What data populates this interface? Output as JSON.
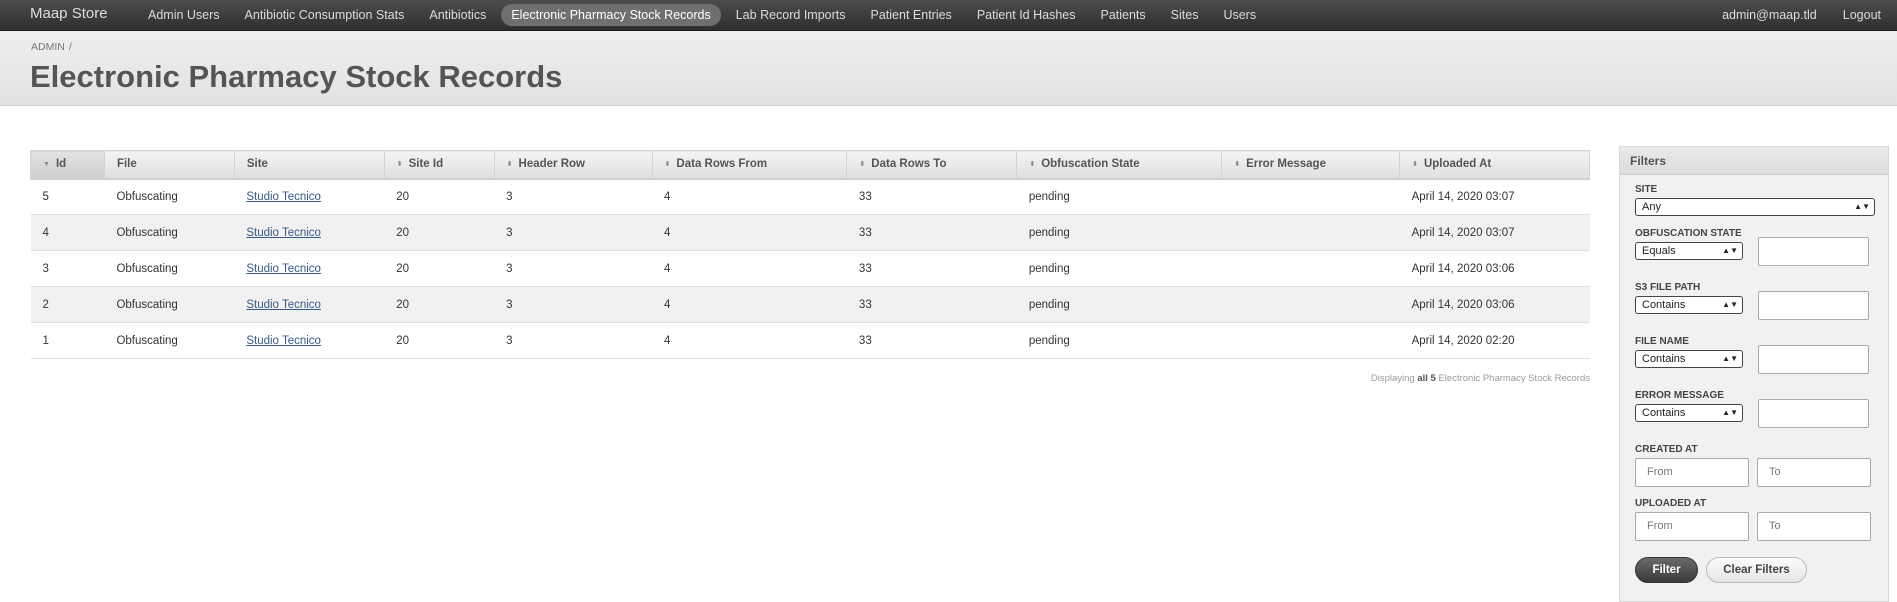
{
  "brand": "Maap Store",
  "nav": {
    "items": [
      {
        "label": "Admin Users",
        "active": false
      },
      {
        "label": "Antibiotic Consumption Stats",
        "active": false
      },
      {
        "label": "Antibiotics",
        "active": false
      },
      {
        "label": "Electronic Pharmacy Stock Records",
        "active": true
      },
      {
        "label": "Lab Record Imports",
        "active": false
      },
      {
        "label": "Patient Entries",
        "active": false
      },
      {
        "label": "Patient Id Hashes",
        "active": false
      },
      {
        "label": "Patients",
        "active": false
      },
      {
        "label": "Sites",
        "active": false
      },
      {
        "label": "Users",
        "active": false
      }
    ],
    "user": "admin@maap.tld",
    "logout": "Logout"
  },
  "breadcrumb": {
    "root": "ADMIN",
    "separator": "/"
  },
  "page_title": "Electronic Pharmacy Stock Records",
  "table": {
    "columns": [
      "Id",
      "File",
      "Site",
      "Site Id",
      "Header Row",
      "Data Rows From",
      "Data Rows To",
      "Obfuscation State",
      "Error Message",
      "Uploaded At"
    ],
    "sorted_column": "Id",
    "rows": [
      {
        "id": "5",
        "file": "Obfuscating",
        "site": "Studio Tecnico",
        "site_id": "20",
        "header_row": "3",
        "data_rows_from": "4",
        "data_rows_to": "33",
        "obfuscation_state": "pending",
        "error_message": "",
        "uploaded_at": "April 14, 2020 03:07"
      },
      {
        "id": "4",
        "file": "Obfuscating",
        "site": "Studio Tecnico",
        "site_id": "20",
        "header_row": "3",
        "data_rows_from": "4",
        "data_rows_to": "33",
        "obfuscation_state": "pending",
        "error_message": "",
        "uploaded_at": "April 14, 2020 03:07"
      },
      {
        "id": "3",
        "file": "Obfuscating",
        "site": "Studio Tecnico",
        "site_id": "20",
        "header_row": "3",
        "data_rows_from": "4",
        "data_rows_to": "33",
        "obfuscation_state": "pending",
        "error_message": "",
        "uploaded_at": "April 14, 2020 03:06"
      },
      {
        "id": "2",
        "file": "Obfuscating",
        "site": "Studio Tecnico",
        "site_id": "20",
        "header_row": "3",
        "data_rows_from": "4",
        "data_rows_to": "33",
        "obfuscation_state": "pending",
        "error_message": "",
        "uploaded_at": "April 14, 2020 03:06"
      },
      {
        "id": "1",
        "file": "Obfuscating",
        "site": "Studio Tecnico",
        "site_id": "20",
        "header_row": "3",
        "data_rows_from": "4",
        "data_rows_to": "33",
        "obfuscation_state": "pending",
        "error_message": "",
        "uploaded_at": "April 14, 2020 02:20"
      }
    ]
  },
  "pagination": {
    "prefix": "Displaying",
    "count": "all 5",
    "suffix": "Electronic Pharmacy Stock Records"
  },
  "filters": {
    "title": "Filters",
    "site": {
      "label": "SITE",
      "value": "Any"
    },
    "obfuscation_state": {
      "label": "OBFUSCATION STATE",
      "operator": "Equals",
      "value": ""
    },
    "s3_file_path": {
      "label": "S3 FILE PATH",
      "operator": "Contains",
      "value": ""
    },
    "file_name": {
      "label": "FILE NAME",
      "operator": "Contains",
      "value": ""
    },
    "error_message": {
      "label": "ERROR MESSAGE",
      "operator": "Contains",
      "value": ""
    },
    "created_at": {
      "label": "CREATED AT",
      "from_placeholder": "From",
      "to_placeholder": "To"
    },
    "uploaded_at": {
      "label": "UPLOADED AT",
      "from_placeholder": "From",
      "to_placeholder": "To"
    },
    "filter_button": "Filter",
    "clear_button": "Clear Filters"
  },
  "colors": {
    "topbar": "#3a3a3a",
    "active_nav": "#6f6f6f",
    "link": "#38598a",
    "row_alt": "#f1f1f1"
  }
}
